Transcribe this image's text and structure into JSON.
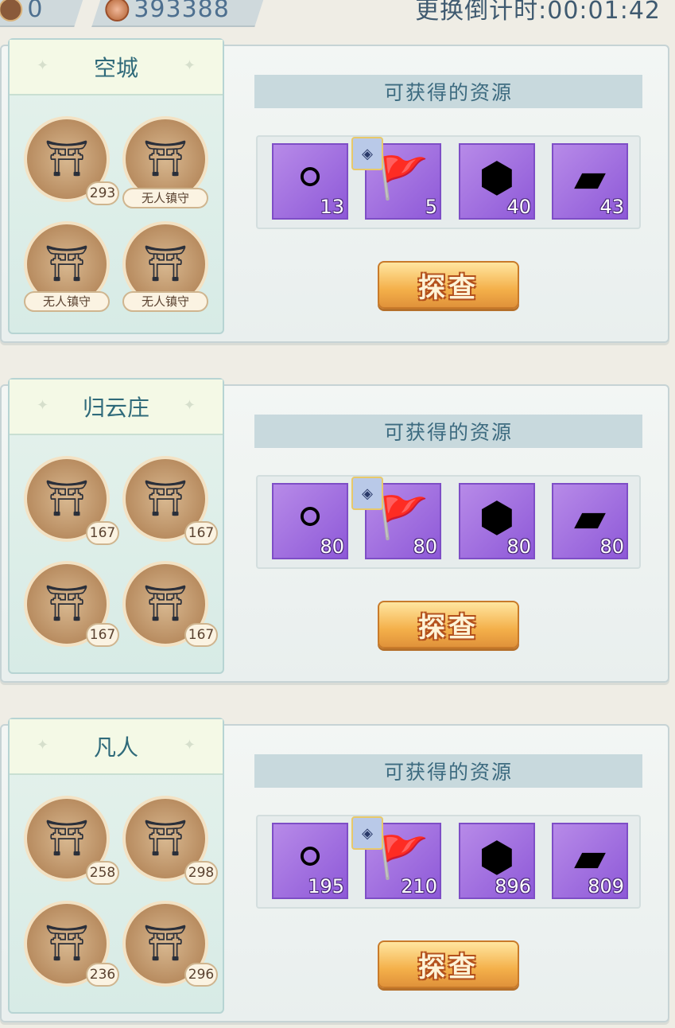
{
  "topbar": {
    "token_value": "0",
    "coin_value": "393388",
    "countdown_label": "更换倒计时",
    "countdown_value": "00:01:42"
  },
  "cards": [
    {
      "name": "空城",
      "buildings": [
        "293",
        "无人镇守",
        "无人镇守",
        "无人镇守"
      ],
      "resource_header": "可获得的资源",
      "resources": [
        {
          "icon": "pearl-icon",
          "count": "13"
        },
        {
          "icon": "banner-icon",
          "count": "5"
        },
        {
          "icon": "ore-icon",
          "count": "40"
        },
        {
          "icon": "cloth-icon",
          "count": "43"
        }
      ],
      "button_label": "探查"
    },
    {
      "name": "归云庄",
      "buildings": [
        "167",
        "167",
        "167",
        "167"
      ],
      "resource_header": "可获得的资源",
      "resources": [
        {
          "icon": "pearl-icon",
          "count": "80"
        },
        {
          "icon": "banner-icon",
          "count": "80"
        },
        {
          "icon": "ore-icon",
          "count": "80"
        },
        {
          "icon": "cloth-icon",
          "count": "80"
        }
      ],
      "button_label": "探查"
    },
    {
      "name": "凡人",
      "buildings": [
        "258",
        "298",
        "236",
        "296"
      ],
      "resource_header": "可获得的资源",
      "resources": [
        {
          "icon": "pearl-icon",
          "count": "195"
        },
        {
          "icon": "banner-icon",
          "count": "210"
        },
        {
          "icon": "ore-icon",
          "count": "896"
        },
        {
          "icon": "cloth-icon",
          "count": "809"
        }
      ],
      "button_label": "探查"
    }
  ]
}
